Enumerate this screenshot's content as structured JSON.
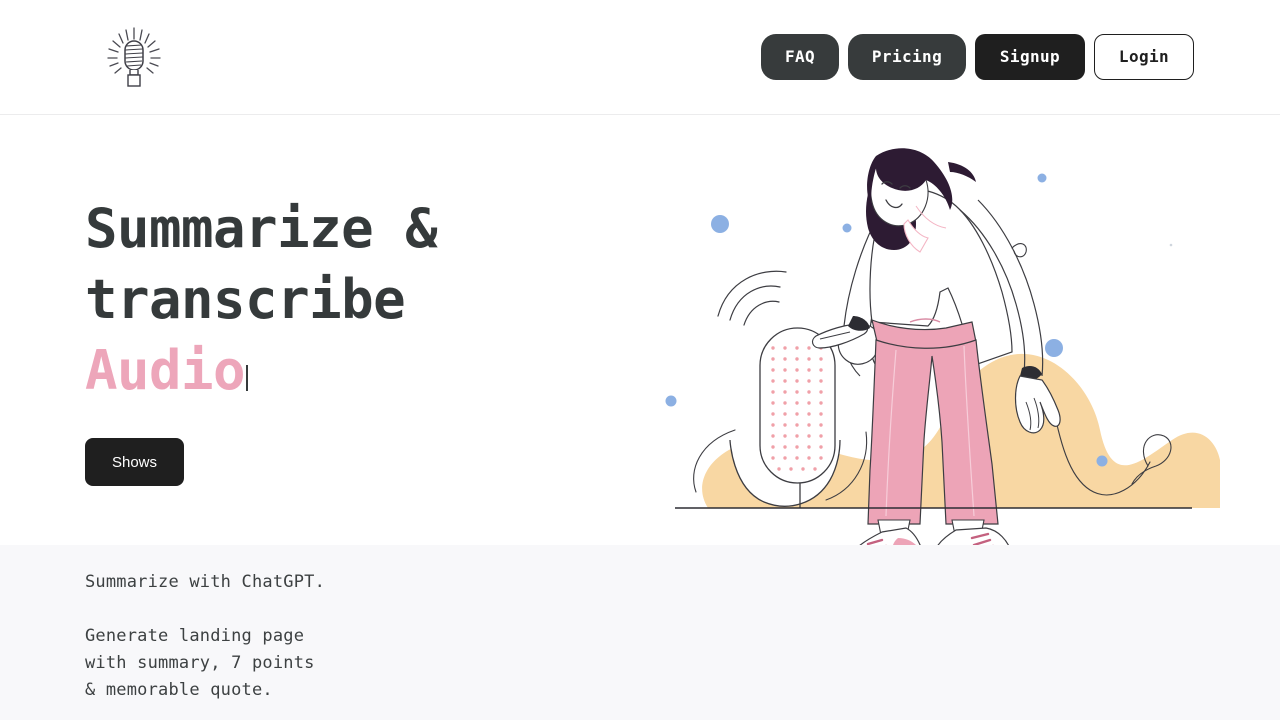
{
  "brand": {
    "logo_icon": "microphone-icon",
    "logo_alt": "Microphone logo"
  },
  "nav": {
    "items": [
      {
        "label": "FAQ",
        "style": "dark"
      },
      {
        "label": "Pricing",
        "style": "dark"
      },
      {
        "label": "Signup",
        "style": "darker"
      },
      {
        "label": "Login",
        "style": "outline"
      }
    ]
  },
  "hero": {
    "headline_line1": "Summarize &",
    "headline_line2": "transcribe",
    "headline_accent": "Audio",
    "cta_label": "Shows"
  },
  "panel": {
    "line_1": "Summarize with ChatGPT.",
    "line_2": "Generate landing page\nwith summary, 7 points\n& memorable quote."
  },
  "illustration": {
    "name": "woman-with-microphone-illustration",
    "blob_color": "#f8d7a3",
    "trousers_color": "#eda4b7",
    "hair_color": "#2d1b33",
    "dot_color": "#8cb0e3",
    "mic_dot_color": "#f0a0a8",
    "line_color": "#3d3d42"
  },
  "colors": {
    "accent_pink": "#eda6ba",
    "text_dark": "#353a3b",
    "nav_dark": "#373b3c",
    "nav_darker": "#1f1f1f",
    "panel_bg": "#f8f8fa"
  }
}
